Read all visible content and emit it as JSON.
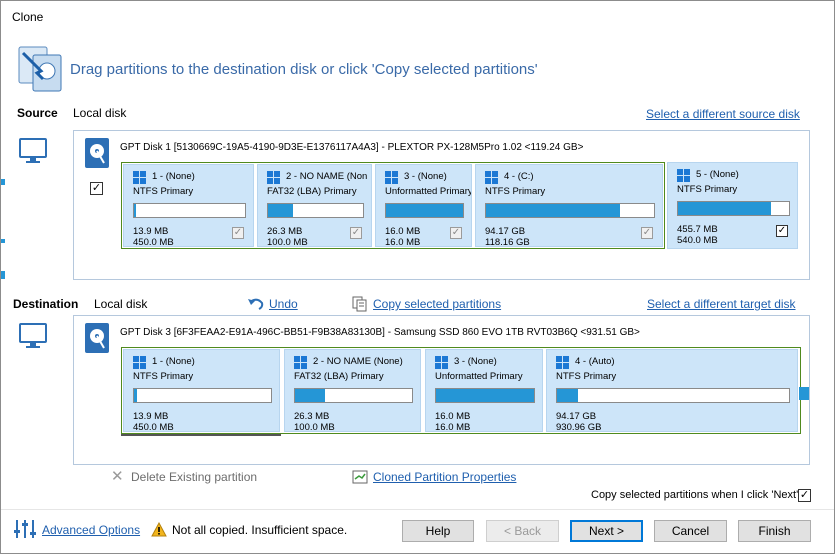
{
  "window": {
    "title": "Clone"
  },
  "header": {
    "text": "Drag partitions to the destination disk or click 'Copy selected partitions'"
  },
  "source": {
    "label": "Source",
    "disk_type": "Local disk",
    "select_link": "Select a different source disk",
    "disk_label": "GPT Disk 1 [5130669C-19A5-4190-9D3E-E1376117A4A3] - PLEXTOR PX-128M5Pro 1.02  <119.24 GB>",
    "disk_selected": true,
    "partitions": [
      {
        "title": "1 -  (None)",
        "type": "NTFS Primary",
        "used": "13.9 MB",
        "total": "450.0 MB",
        "fill": 0.02,
        "checked": true,
        "enabled": false
      },
      {
        "title": "2 - NO NAME (Non",
        "type": "FAT32 (LBA) Primary",
        "used": "26.3 MB",
        "total": "100.0 MB",
        "fill": 0.26,
        "checked": true,
        "enabled": false
      },
      {
        "title": "3 -  (None)",
        "type": "Unformatted Primary",
        "used": "16.0 MB",
        "total": "16.0 MB",
        "fill": 1.0,
        "checked": true,
        "enabled": false
      },
      {
        "title": "4 -  (C:)",
        "type": "NTFS Primary",
        "used": "94.17 GB",
        "total": "118.16 GB",
        "fill": 0.8,
        "checked": true,
        "enabled": false
      },
      {
        "title": "5 -  (None)",
        "type": "NTFS Primary",
        "used": "455.7 MB",
        "total": "540.0 MB",
        "fill": 0.84,
        "checked": true,
        "enabled": true
      }
    ]
  },
  "destination": {
    "label": "Destination",
    "disk_type": "Local disk",
    "undo": "Undo",
    "copy_link": "Copy selected partitions",
    "select_link": "Select a different target disk",
    "disk_label": "GPT Disk 3 [6F3FEAA2-E91A-496C-BB51-F9B38A83130B] - Samsung SSD 860 EVO 1TB RVT03B6Q  <931.51 GB>",
    "partitions": [
      {
        "title": "1 -  (None)",
        "type": "NTFS Primary",
        "used": "13.9 MB",
        "total": "450.0 MB",
        "fill": 0.02
      },
      {
        "title": "2 - NO NAME (None)",
        "type": "FAT32 (LBA) Primary",
        "used": "26.3 MB",
        "total": "100.0 MB",
        "fill": 0.26
      },
      {
        "title": "3 -  (None)",
        "type": "Unformatted Primary",
        "used": "16.0 MB",
        "total": "16.0 MB",
        "fill": 1.0
      },
      {
        "title": "4 -  (Auto)",
        "type": "NTFS Primary",
        "used": "94.17 GB",
        "total": "930.96 GB",
        "fill": 0.09
      }
    ]
  },
  "actions": {
    "delete": "Delete Existing partition",
    "properties": "Cloned Partition Properties",
    "copy_on_next": "Copy selected partitions when I click 'Next'",
    "copy_on_next_checked": true
  },
  "footer": {
    "advanced": "Advanced Options",
    "warning": "Not all copied. Insufficient space.",
    "help": "Help",
    "back": "< Back",
    "next": "Next >",
    "cancel": "Cancel",
    "finish": "Finish"
  },
  "colors": {
    "accent": "#2596d6",
    "link": "#1f5fae",
    "partition_bg": "#cde5f9",
    "group_border": "#4f8a1e"
  }
}
